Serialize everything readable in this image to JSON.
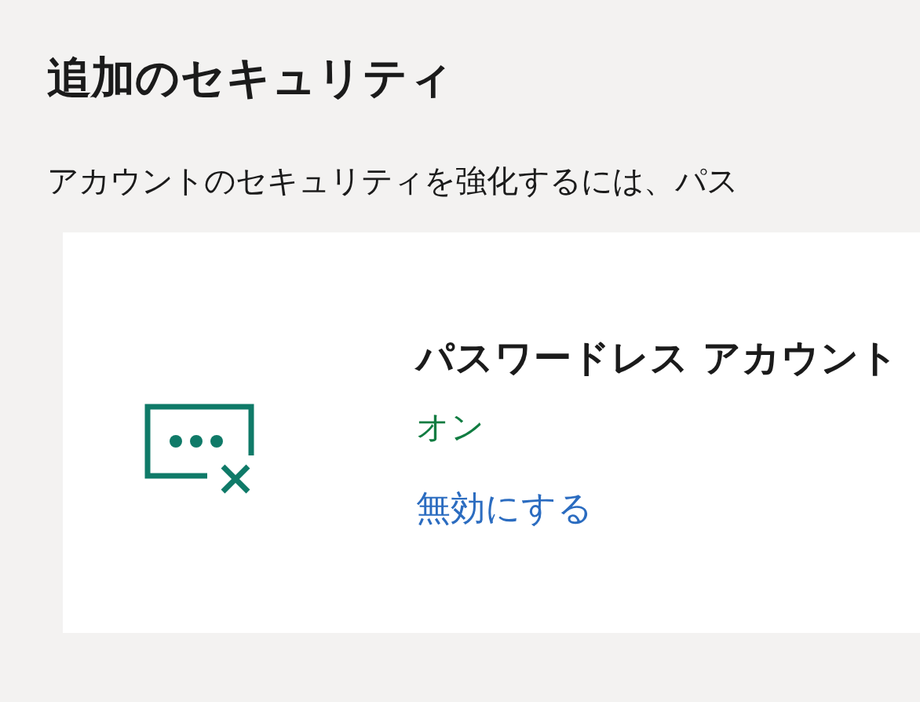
{
  "heading": "追加のセキュリティ",
  "description": "アカウントのセキュリティを強化するには、パス",
  "card": {
    "title": "パスワードレス アカウント",
    "status": "オン",
    "on": true,
    "action": "無効にする"
  }
}
